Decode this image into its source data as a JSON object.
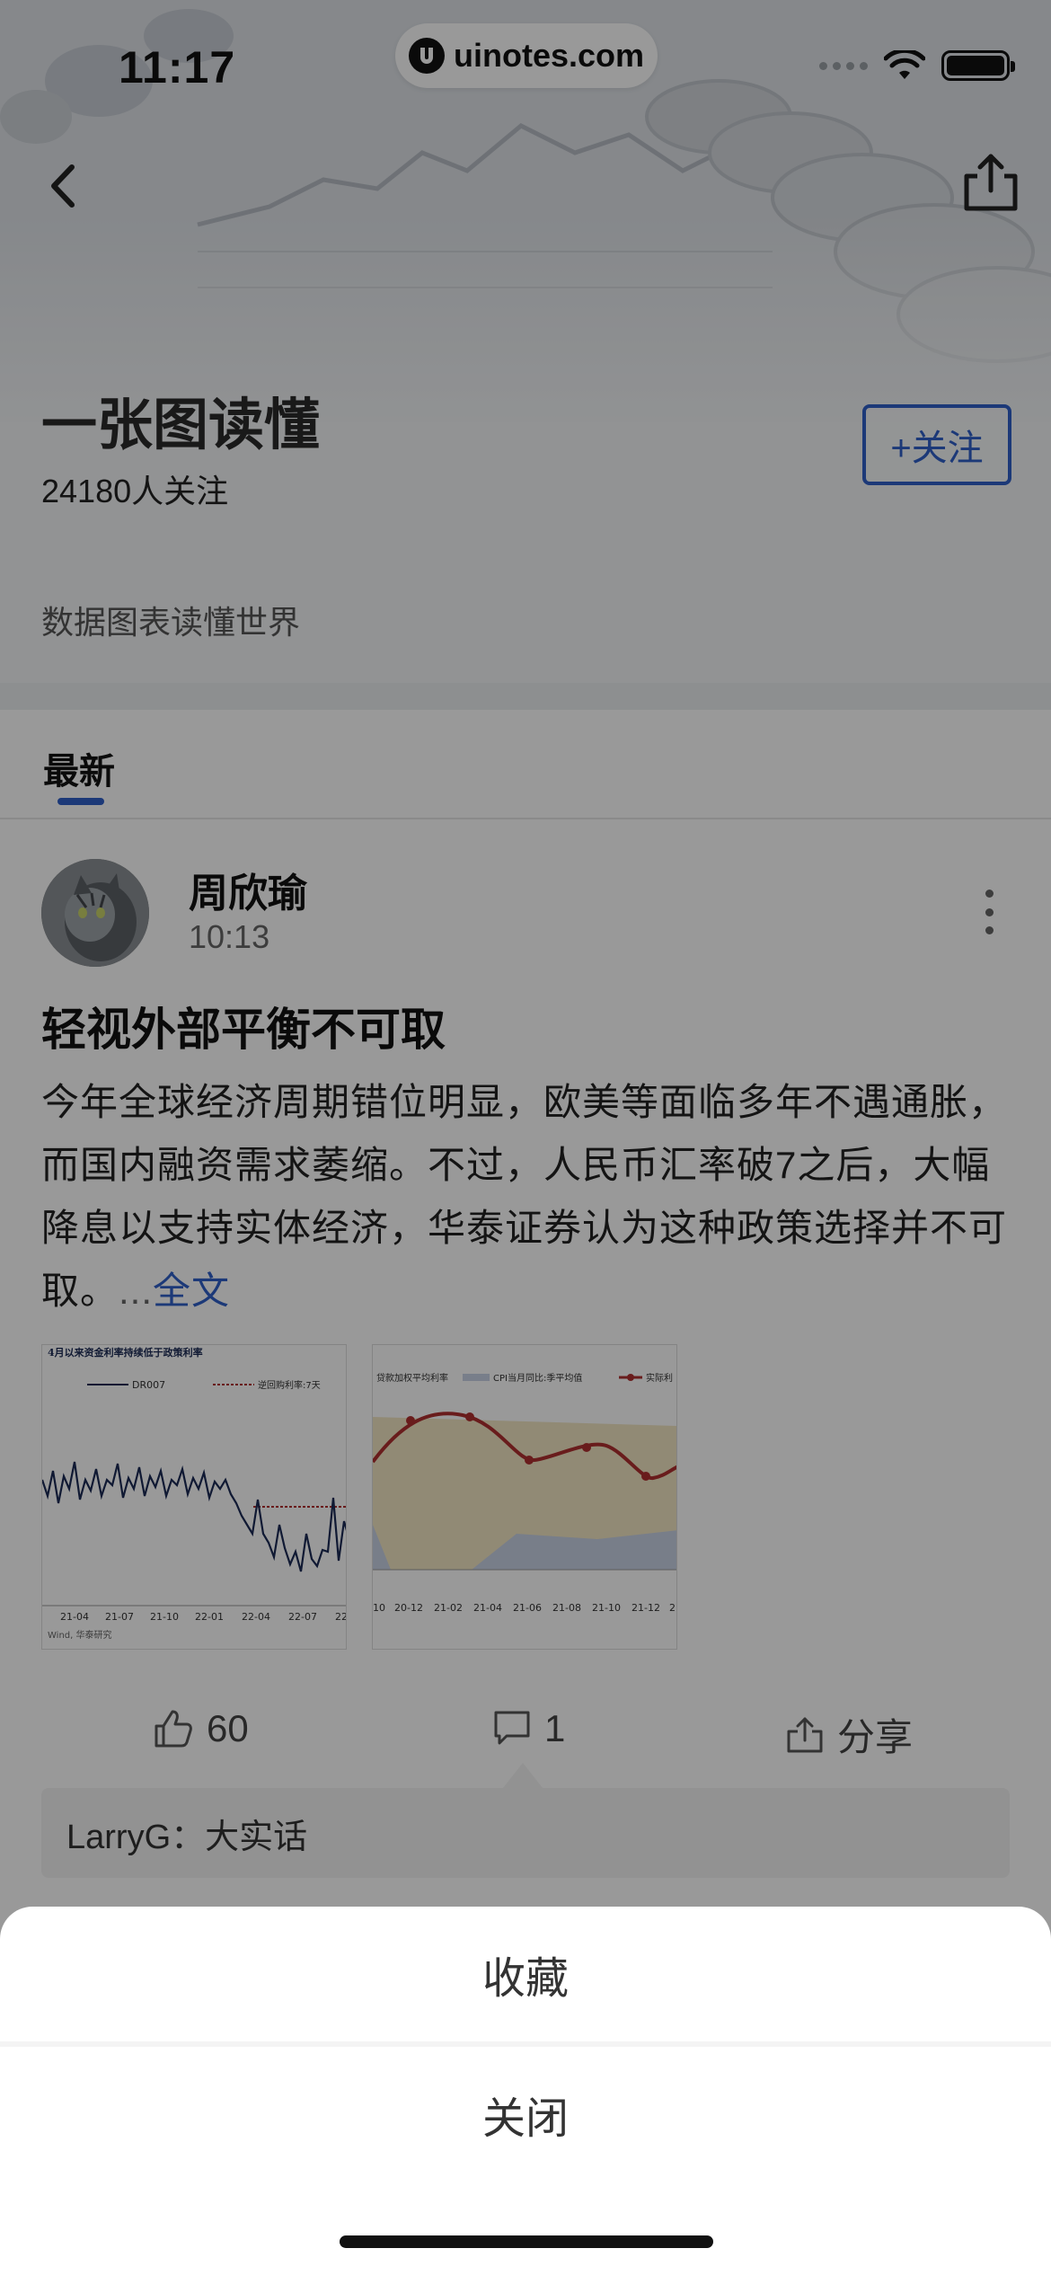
{
  "status_bar": {
    "time": "11:17",
    "url": "uinotes.com"
  },
  "channel": {
    "title": "一张图读懂",
    "followers": "24180人关注",
    "follow_button": "+关注",
    "description": "数据图表读懂世界"
  },
  "tabs": {
    "latest": "最新"
  },
  "post": {
    "author": "周欣瑜",
    "time": "10:13",
    "title": "轻视外部平衡不可取",
    "body": "今年全球经济周期错位明显，欧美等面临多年不遇通胀，而国内融资需求萎缩。不过，人民币汇率破7之后，大幅降息以支持实体经济，华泰证券认为这种政策选择并不可取。",
    "ellipsis": "...",
    "more_link": "全文",
    "thumb1": {
      "title": "4月以来资金利率持续低于政策利率",
      "legend_a": "DR007",
      "legend_b": "逆回购利率:7天",
      "ticks": [
        "21-04",
        "21-07",
        "21-10",
        "22-01",
        "22-04",
        "22-07",
        "22"
      ],
      "source": "Wind, 华泰研究"
    },
    "thumb2": {
      "legend_a": "贷款加权平均利率",
      "legend_b": "CPI当月同比:季平均值",
      "legend_c": "实际利",
      "ticks": [
        "10",
        "20-12",
        "21-02",
        "21-04",
        "21-06",
        "21-08",
        "21-10",
        "21-12",
        "2"
      ]
    },
    "likes": "60",
    "comments": "1",
    "share": "分享",
    "comment_preview": "LarryG：大实话"
  },
  "sheet": {
    "favorite": "收藏",
    "close": "关闭"
  },
  "colors": {
    "accent": "#2f5fc9",
    "overlay": "rgba(0,0,0,0.4)"
  }
}
